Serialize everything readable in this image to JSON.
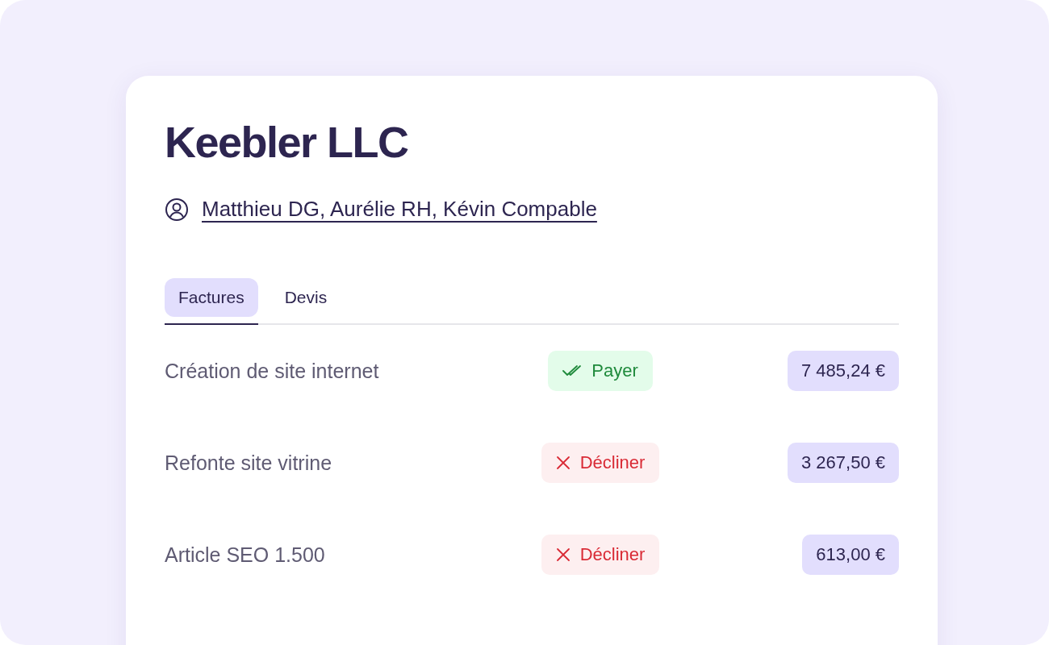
{
  "company": {
    "name": "Keebler LLC"
  },
  "contacts": {
    "text": "Matthieu DG, Aurélie RH, Kévin Compable"
  },
  "tabs": [
    {
      "label": "Factures",
      "selected": true
    },
    {
      "label": "Devis",
      "selected": false
    }
  ],
  "rows": [
    {
      "title": "Création de site internet",
      "status": {
        "kind": "pay",
        "label": "Payer"
      },
      "amount": "7 485,24 €"
    },
    {
      "title": "Refonte site vitrine",
      "status": {
        "kind": "decline",
        "label": "Décliner"
      },
      "amount": "3 267,50 €"
    },
    {
      "title": "Article SEO 1.500",
      "status": {
        "kind": "decline",
        "label": "Décliner"
      },
      "amount": "613,00 €"
    }
  ]
}
